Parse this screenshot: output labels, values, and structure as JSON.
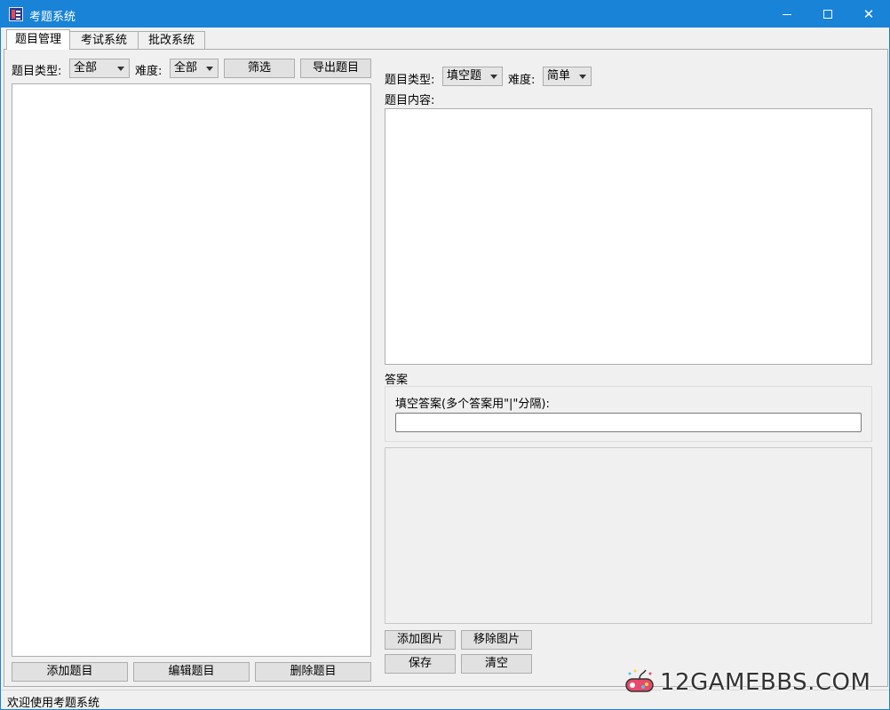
{
  "window": {
    "title": "考题系统"
  },
  "tabs": [
    {
      "label": "题目管理",
      "active": true
    },
    {
      "label": "考试系统",
      "active": false
    },
    {
      "label": "批改系统",
      "active": false
    }
  ],
  "left": {
    "type_label": "题目类型:",
    "type_value": "全部",
    "difficulty_label": "难度:",
    "difficulty_value": "全部",
    "filter_button": "筛选",
    "export_button": "导出题目",
    "add_button": "添加题目",
    "edit_button": "编辑题目",
    "delete_button": "删除题目"
  },
  "right": {
    "type_label": "题目类型:",
    "type_value": "填空题",
    "difficulty_label": "难度:",
    "difficulty_value": "简单",
    "content_label": "题目内容:",
    "answer_label": "答案",
    "fill_answer_label": "填空答案(多个答案用\"|\"分隔):",
    "fill_answer_value": "",
    "add_image_button": "添加图片",
    "remove_image_button": "移除图片",
    "save_button": "保存",
    "clear_button": "清空"
  },
  "status": {
    "text": "欢迎使用考题系统"
  },
  "watermark": {
    "text": "12GAMEBBS.COM"
  },
  "colors": {
    "titlebar": "#1883d7",
    "panel": "#f0f0f0"
  }
}
